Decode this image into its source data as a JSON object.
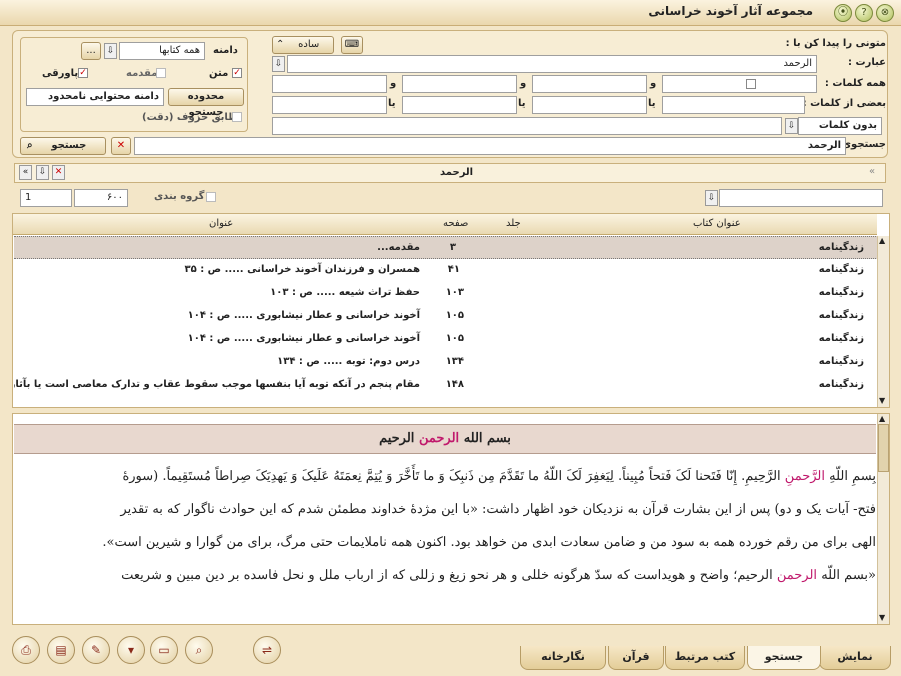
{
  "window": {
    "title": "مجموعه آثار آخوند خراسانی",
    "help_glyph": "?",
    "close_glyph": "⊗"
  },
  "search_panel": {
    "find_text_label": "متونی را پیدا کن با :",
    "phrase_label": "عبارت :",
    "phrase_value": "الرحمد",
    "all_words_label": "همه کلمات :",
    "any_words_label": "بعضی از کلمات :",
    "and_word": "و",
    "or_word": "یا",
    "without_words_label": "بدون کلمات",
    "mode_value": "ساده",
    "domain_label": "دامنه",
    "domain_value": "همه کتابها",
    "ellipsis": "...",
    "text_label": "متن",
    "intro_label": "مقدمه",
    "footnote_label": "پاورقی",
    "search_scope_button": "محدوده جستجو",
    "scope_value": "دامنه محتوایی نامحدود",
    "exact_match_label": "تطابق حروف (دقت)",
    "search_for_label": "جستجوی",
    "search_for_value": "الرحمد",
    "search_button": "جستجو"
  },
  "results_bar": {
    "query_display": "الرحمد",
    "group_label": "گروه بندی",
    "page_value": "۶۰۰",
    "index_value": "1"
  },
  "table": {
    "columns": {
      "book_title": "عنوان کتاب",
      "volume": "جلد",
      "page": "صفحه",
      "title": "عنوان"
    },
    "rows": [
      {
        "book": "زندگینامه",
        "page": "۳",
        "title": "مقدمه..."
      },
      {
        "book": "زندگینامه",
        "page": "۴۱",
        "title": "همسران و فرزندان آخوند خراسانی ..... ص : ۳۵"
      },
      {
        "book": "زندگینامه",
        "page": "۱۰۳",
        "title": "حفظ تراث شیعه ..... ص : ۱۰۳"
      },
      {
        "book": "زندگینامه",
        "page": "۱۰۵",
        "title": "آخوند خراسانی و عطار نیشابوری ..... ص : ۱۰۴"
      },
      {
        "book": "زندگینامه",
        "page": "۱۰۵",
        "title": "آخوند خراسانی و عطار نیشابوری ..... ص : ۱۰۴"
      },
      {
        "book": "زندگینامه",
        "page": "۱۳۴",
        "title": "درس دوم: توبه ..... ص : ۱۳۴"
      },
      {
        "book": "زندگینامه",
        "page": "۱۴۸",
        "title": "مقام پنجم در آنکه توبه آیا بنفسها موجب سقوط عقاب و تدارک معاصی است یا بآثار ..."
      }
    ]
  },
  "reader": {
    "heading_a": "بسم الله",
    "heading_b": "الرحمن",
    "heading_c": "الرحیم",
    "line1_a": "بِسمِ اللّهِ",
    "line1_b": "الرَّحمنِ",
    "line1_c": "الرَّحِیمِ. إِنّا فَتَحنا لَکَ فَتحاً مُبِیناً. لِیَغفِرَ لَکَ اللّهُ ما تَقَدَّمَ مِن ذَنبِکَ وَ ما تَأَخَّرَ وَ یُتِمَّ نِعمَتَهُ عَلَیکَ وَ یَهدِیَکَ صِراطاً مُستَقِیماً. (سورهٔ",
    "line2": "فتح- آیات یک و دو) پس از این بشارت قرآن به نزدیکان خود اظهار داشت: «با این مژدهٔ خداوند مطمئن شدم که این حوادث ناگوار که به تقدیر",
    "line3": "الهی برای من رقم خورده همه به سود من و ضامن سعادت ابدی من خواهد بود. اکنون همه ناملایمات حتی مرگ، برای من گوارا و شیرین است».",
    "line4_a": "«بسم اللّه",
    "line4_b": "الرحمن",
    "line4_c": "الرحیم؛ واضح و هویداست که سدّ هرگونه خللی و هر نحو زیغ و زللی که از ارباب ملل و نحل فاسده بر دین مبین و شریعت"
  },
  "tabs": {
    "display": "نمایش",
    "search": "جستجو",
    "related_books": "کتب مرتبط",
    "quran": "قرآن",
    "gallery": "نگارخانه"
  },
  "toolbar_icons": [
    "print-icon",
    "book-icon",
    "note-icon",
    "dropdown-icon",
    "page-icon",
    "zoom-icon",
    "link-icon"
  ],
  "colors": {
    "accent_pink": "#c0196c",
    "frame": "#f3e6c8",
    "selected_row": "#ddd2c9"
  }
}
